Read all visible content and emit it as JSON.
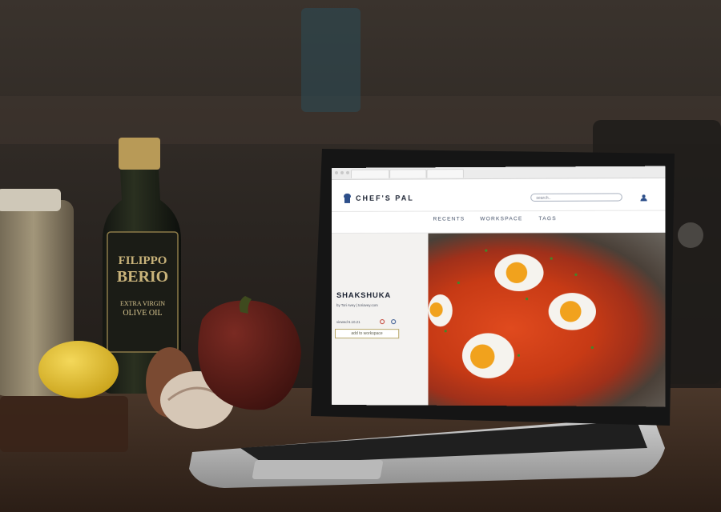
{
  "site": {
    "brand": "CHEF'S PAL",
    "search_placeholder": "search..",
    "nav": [
      "RECENTS",
      "WORKSPACE",
      "TAGS"
    ]
  },
  "recipe": {
    "title": "SHAKSHUKA",
    "byline": "by Tori Avey | toriavey.com",
    "viewed": "viewed 6.10.21",
    "add_button": "add to workspace"
  },
  "bottle": {
    "brand_line1": "FILIPPO",
    "brand_line2": "BERIO",
    "label_line1": "EXTRA VIRGIN",
    "label_line2": "OLIVE OIL"
  },
  "colors": {
    "brand_blue": "#2d4f8a",
    "button_border": "#b8a86a"
  }
}
